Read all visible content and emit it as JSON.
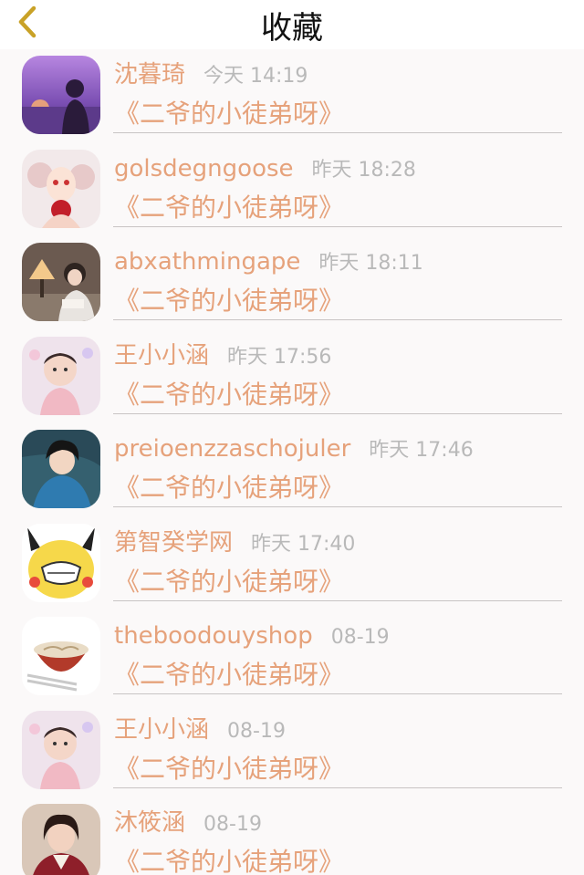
{
  "nav": {
    "title": "收藏",
    "back_icon": "chevron-left-icon",
    "accent": "#c9a227"
  },
  "colors": {
    "name": "#e6a27b",
    "time": "#b9b9b9",
    "background": "#fbf9f9"
  },
  "items": [
    {
      "name": "沈暮琦",
      "time": "今天 14:19",
      "book": "《二爷的小徒弟呀》",
      "avatar": "sunset-portrait"
    },
    {
      "name": "golsdegngoose",
      "time": "昨天 18:28",
      "book": "《二爷的小徒弟呀》",
      "avatar": "illustrated-girl"
    },
    {
      "name": "abxathmingape",
      "time": "昨天 18:11",
      "book": "《二爷的小徒弟呀》",
      "avatar": "girl-with-lamp"
    },
    {
      "name": "王小小涵",
      "time": "昨天 17:56",
      "book": "《二爷的小徒弟呀》",
      "avatar": "child-photo"
    },
    {
      "name": "preioenzzaschojuler",
      "time": "昨天 17:46",
      "book": "《二爷的小徒弟呀》",
      "avatar": "anime-boy"
    },
    {
      "name": "第智癸学网",
      "time": "昨天 17:40",
      "book": "《二爷的小徒弟呀》",
      "avatar": "yellow-meme-face"
    },
    {
      "name": "theboodouyshop",
      "time": "08-19",
      "book": "《二爷的小徒弟呀》",
      "avatar": "noodle-bowl"
    },
    {
      "name": "王小小涵",
      "time": "08-19",
      "book": "《二爷的小徒弟呀》",
      "avatar": "child-photo"
    },
    {
      "name": "沐筱涵",
      "time": "08-19",
      "book": "《二爷的小徒弟呀》",
      "avatar": "woman-portrait"
    }
  ]
}
